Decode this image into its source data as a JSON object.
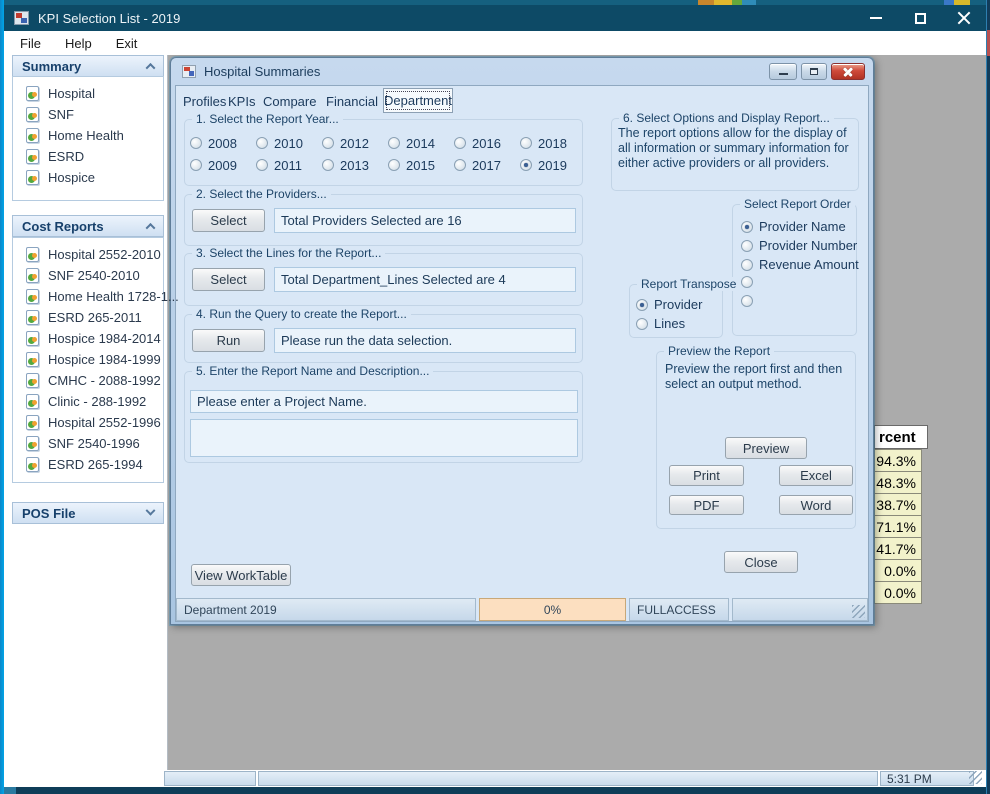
{
  "screen": {
    "time": "5:31 PM"
  },
  "main_window": {
    "title": "KPI Selection List - 2019",
    "menu": {
      "file": "File",
      "help": "Help",
      "exit": "Exit"
    },
    "sidebar": {
      "summary": {
        "label": "Summary",
        "items": [
          "Hospital",
          "SNF",
          "Home Health",
          "ESRD",
          "Hospice"
        ]
      },
      "cost_reports": {
        "label": "Cost Reports",
        "items": [
          "Hospital 2552-2010",
          "SNF 2540-2010",
          "Home Health 1728-1...",
          "ESRD 265-2011",
          "Hospice 1984-2014",
          "Hospice 1984-1999",
          "CMHC - 2088-1992",
          "Clinic - 288-1992",
          "Hospital 2552-1996",
          "SNF 2540-1996",
          "ESRD 265-1994"
        ]
      },
      "pos_file": {
        "label": "POS File"
      }
    }
  },
  "dialog": {
    "title": "Hospital Summaries",
    "tabs": [
      "Profiles",
      "KPIs",
      "Compare",
      "Financial",
      "Department"
    ],
    "active_tab": "Department",
    "year_group": {
      "label": "1.  Select the Report Year...",
      "years": [
        "2008",
        "2009",
        "2010",
        "2011",
        "2012",
        "2013",
        "2014",
        "2015",
        "2016",
        "2017",
        "2018",
        "2019"
      ],
      "selected": "2019"
    },
    "providers_group": {
      "label": "2.  Select the Providers...",
      "button": "Select",
      "value": "Total Providers Selected are 16"
    },
    "lines_group": {
      "label": "3.  Select the Lines for the Report...",
      "button": "Select",
      "value": "Total Department_Lines Selected are 4"
    },
    "run_group": {
      "label": "4.  Run the Query to create the Report...",
      "button": "Run",
      "value": "Please run the data selection."
    },
    "name_group": {
      "label": "5.  Enter the Report Name and Description...",
      "name_value": "Please enter a Project Name.",
      "description_value": ""
    },
    "options_group": {
      "label": "6.  Select Options and Display Report...",
      "text": "The report options allow for the display of all information or summary information for either active providers or all providers."
    },
    "order_group": {
      "label": "Select Report Order",
      "options": [
        "Provider Name",
        "Provider Number",
        "Revenue Amount",
        "",
        ""
      ],
      "selected": "Provider Name"
    },
    "transpose_group": {
      "label": "Report Transpose",
      "options": [
        "Provider",
        "Lines"
      ],
      "selected": "Provider"
    },
    "preview_group": {
      "label": "Preview the Report",
      "text": "Preview the report first and then select an output method.",
      "preview": "Preview",
      "print": "Print",
      "excel": "Excel",
      "pdf": "PDF",
      "word": "Word"
    },
    "view_worktable": "View WorkTable",
    "close": "Close",
    "status": {
      "left": "Department 2019",
      "progress": "0%",
      "access": "FULLACCESS"
    }
  },
  "background_table": {
    "header": "rcent",
    "rows": [
      "94.3%",
      "48.3%",
      "38.7%",
      "71.1%",
      "41.7%",
      "0.0%",
      "0.0%"
    ]
  },
  "colors": {
    "titlebar": "#0d4a66",
    "accent_blue": "#00a5e8",
    "progress_peach": "#fcdfc0",
    "table_yellow": "#f2f2cb",
    "close_red": "#cf4a3a"
  }
}
